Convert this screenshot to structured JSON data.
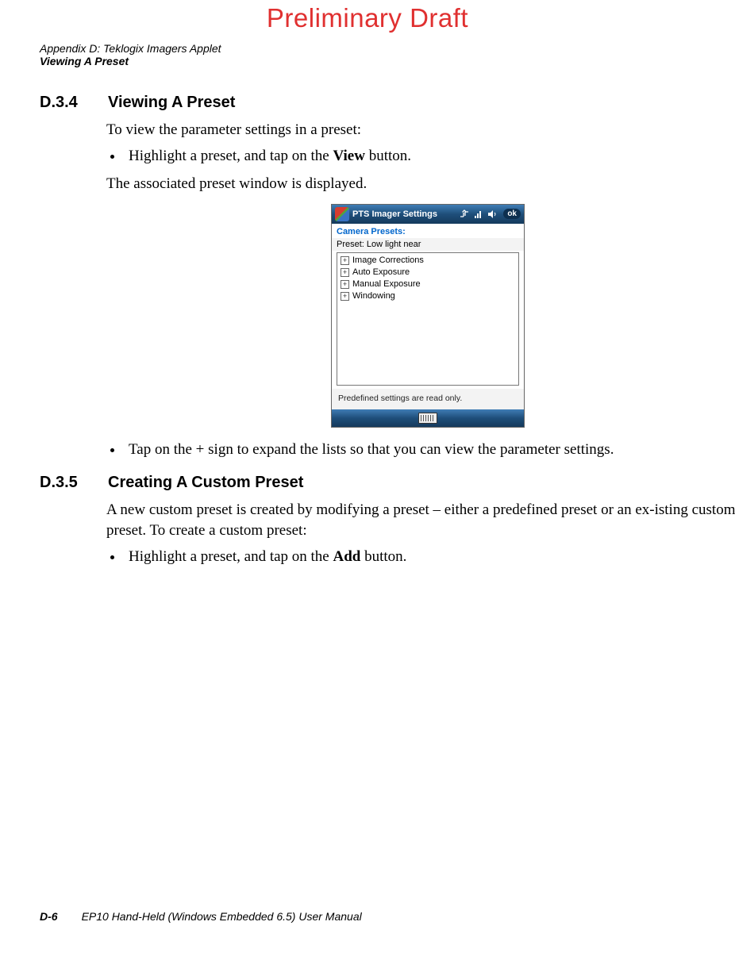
{
  "watermark": "Preliminary Draft",
  "header": {
    "line1": "Appendix D: Teklogix Imagers Applet",
    "line2": "Viewing A Preset"
  },
  "section_d34": {
    "num": "D.3.4",
    "title": "Viewing A Preset",
    "intro": "To view the parameter settings in a preset:",
    "bullet1_pre": "Highlight a preset, and tap on the ",
    "bullet1_bold": "View",
    "bullet1_post": " button.",
    "after_bullet": "The associated preset window is displayed.",
    "bullet2": "Tap on the + sign to expand the lists so that you can view the parameter settings."
  },
  "device": {
    "title": "PTS Imager Settings",
    "ok": "ok",
    "subheader": "Camera Presets:",
    "preset_label": "Preset:  Low light near",
    "tree": {
      "item0": "Image Corrections",
      "item1": "Auto Exposure",
      "item2": "Manual Exposure",
      "item3": "Windowing"
    },
    "status": "Predefined settings are read only."
  },
  "section_d35": {
    "num": "D.3.5",
    "title": "Creating A Custom Preset",
    "p1": "A new custom preset is created by modifying a preset – either a predefined preset or an ex-isting custom preset. To create a custom preset:",
    "bullet1_pre": "Highlight a preset, and tap on the ",
    "bullet1_bold": "Add",
    "bullet1_post": " button."
  },
  "footer": {
    "page": "D-6",
    "book": "EP10 Hand-Held (Windows Embedded 6.5) User Manual"
  }
}
